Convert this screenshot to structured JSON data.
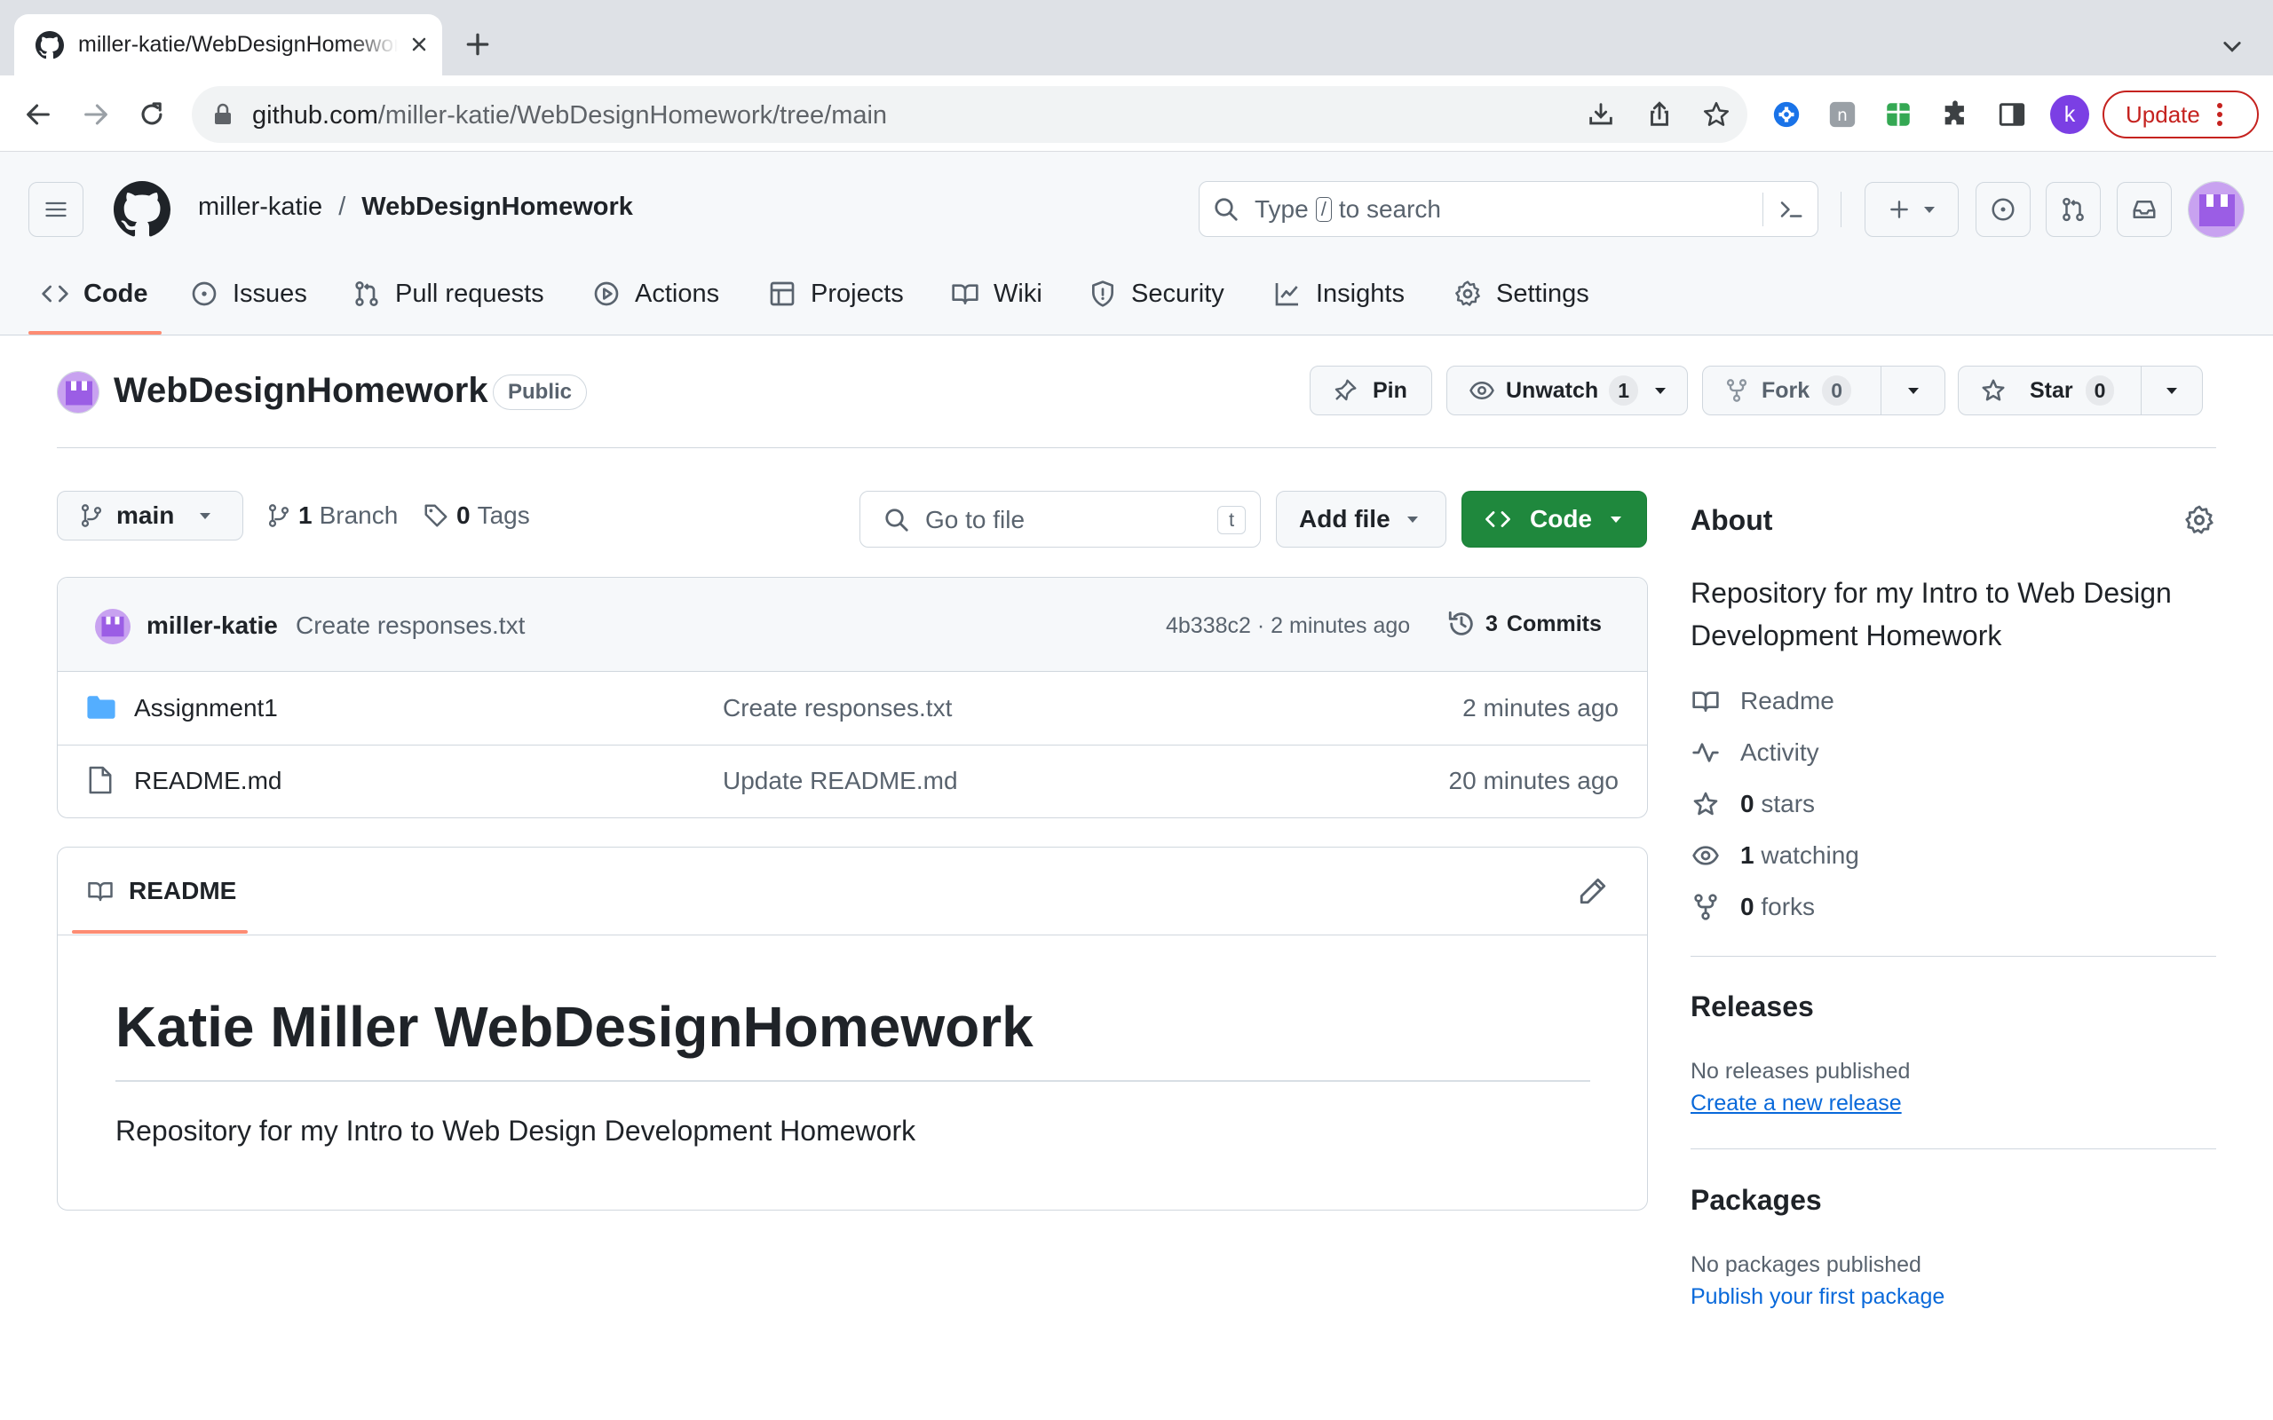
{
  "browser": {
    "tab_title": "miller-katie/WebDesignHomework",
    "url_host": "github.com",
    "url_path": "/miller-katie/WebDesignHomework/tree/main",
    "profile_initial": "k",
    "update_label": "Update"
  },
  "header": {
    "owner": "miller-katie",
    "separator": "/",
    "repo": "WebDesignHomework",
    "search_prefix": "Type",
    "search_key": "/",
    "search_suffix": "to search"
  },
  "nav": {
    "tabs": [
      {
        "label": "Code",
        "icon": "code-icon",
        "active": true
      },
      {
        "label": "Issues",
        "icon": "issue-icon"
      },
      {
        "label": "Pull requests",
        "icon": "pull-request-icon"
      },
      {
        "label": "Actions",
        "icon": "play-icon"
      },
      {
        "label": "Projects",
        "icon": "table-icon"
      },
      {
        "label": "Wiki",
        "icon": "book-icon"
      },
      {
        "label": "Security",
        "icon": "shield-icon"
      },
      {
        "label": "Insights",
        "icon": "graph-icon"
      },
      {
        "label": "Settings",
        "icon": "gear-icon"
      }
    ]
  },
  "repo": {
    "name": "WebDesignHomework",
    "visibility": "Public",
    "pin_label": "Pin",
    "unwatch_label": "Unwatch",
    "watch_count": "1",
    "fork_label": "Fork",
    "fork_count": "0",
    "star_label": "Star",
    "star_count": "0"
  },
  "files": {
    "branch": "main",
    "branch_count": "1",
    "branch_label": "Branch",
    "tag_count": "0",
    "tag_label": "Tags",
    "go_to_file_placeholder": "Go to file",
    "go_to_file_key": "t",
    "add_file_label": "Add file",
    "code_label": "Code",
    "commit": {
      "author": "miller-katie",
      "message": "Create responses.txt",
      "meta": "4b338c2 · 2 minutes ago",
      "commits_count": "3",
      "commits_label": "Commits"
    },
    "rows": [
      {
        "type": "folder",
        "name": "Assignment1",
        "message": "Create responses.txt",
        "time": "2 minutes ago"
      },
      {
        "type": "file",
        "name": "README.md",
        "message": "Update README.md",
        "time": "20 minutes ago"
      }
    ]
  },
  "readme": {
    "tab_label": "README",
    "heading": "Katie Miller WebDesignHomework",
    "body": "Repository for my Intro to Web Design Development Homework"
  },
  "sidebar": {
    "about_title": "About",
    "description": "Repository for my Intro to Web Design Development Homework",
    "readme_label": "Readme",
    "activity_label": "Activity",
    "stars_count": "0",
    "stars_label": "stars",
    "watching_count": "1",
    "watching_label": "watching",
    "forks_count": "0",
    "forks_label": "forks",
    "releases_title": "Releases",
    "releases_empty": "No releases published",
    "releases_link": "Create a new release",
    "packages_title": "Packages",
    "packages_empty": "No packages published",
    "packages_link": "Publish your first package"
  },
  "colors": {
    "accent_green": "#1f883d",
    "link_blue": "#0969da",
    "nav_underline": "#fd8c73",
    "update_red": "#c5221f"
  }
}
